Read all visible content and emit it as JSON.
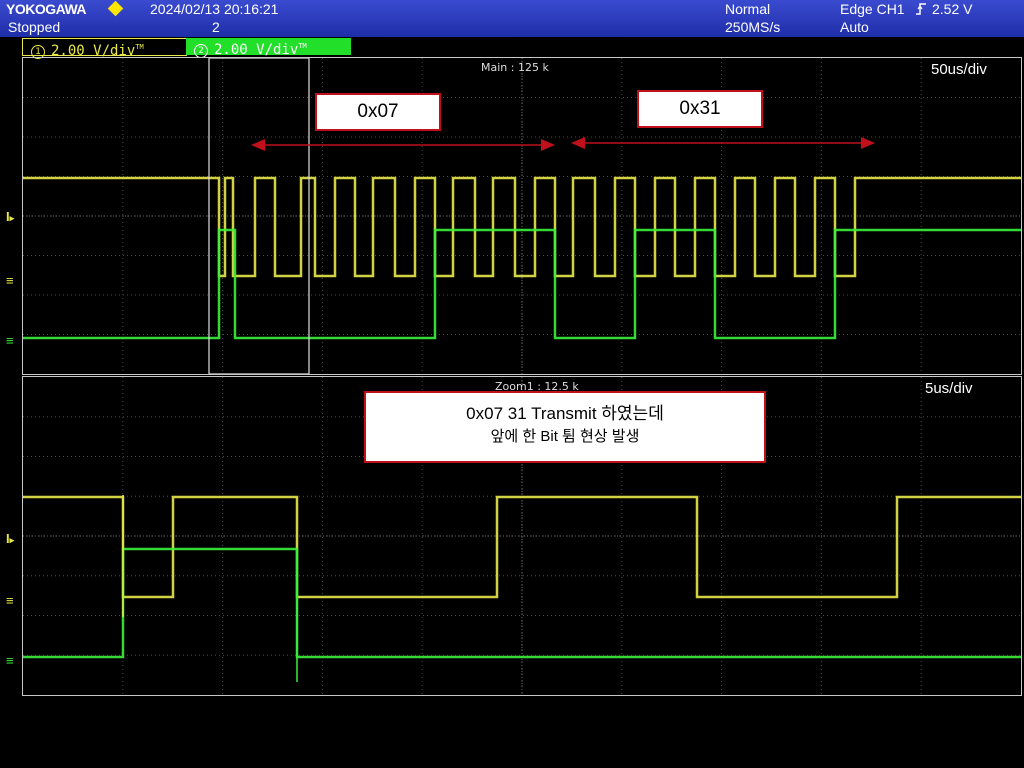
{
  "header": {
    "brand": "YOKOGAWA",
    "status": "Stopped",
    "datetime": "2024/02/13 20:16:21",
    "acq_count": "2",
    "mode": "Normal",
    "sample_rate": "250MS/s",
    "trigger": "Edge CH1",
    "trigger_level": "2.52 V",
    "trigger_mode": "Auto"
  },
  "channels": [
    {
      "num": "1",
      "scale": "2.00 V/div",
      "suffix": "TM",
      "color": "#e8e84a"
    },
    {
      "num": "2",
      "scale": "2.00 V/div",
      "suffix": "TM",
      "color": "#22e02a"
    }
  ],
  "main": {
    "record": "Main : 125 k",
    "timebase": "50us/div",
    "label_a": "0x07",
    "label_b": "0x31"
  },
  "zoom": {
    "record": "Zoom1 : 12.5 k",
    "timebase": "5us/div",
    "note_line1": "0x07 31 Transmit 하였는데",
    "note_line2": "앞에 한 Bit 튐 현상 발생"
  },
  "colors": {
    "ch1": "#e8e84a",
    "ch2": "#3cf03c",
    "grid": "#555555",
    "annot": "#c0101a"
  }
}
